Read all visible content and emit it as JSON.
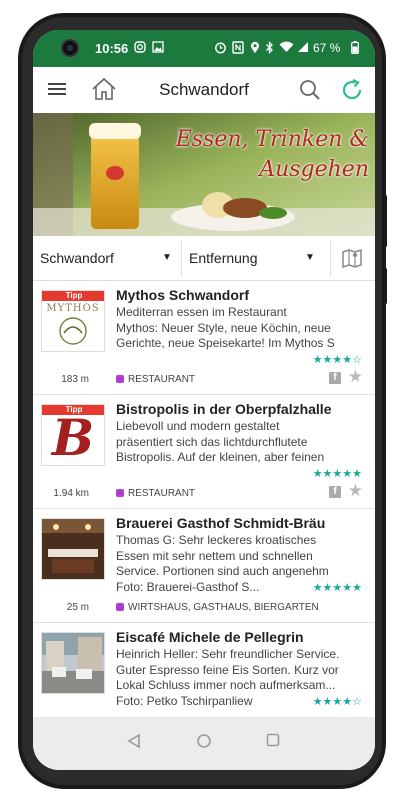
{
  "status": {
    "time": "10:56",
    "battery": "67 %"
  },
  "toolbar": {
    "title": "Schwandorf"
  },
  "banner": {
    "line1": "Essen, Trinken &",
    "line2": "Ausgehen"
  },
  "filters": {
    "location": "Schwandorf",
    "sort": "Entfernung"
  },
  "items": [
    {
      "name": "Mythos Schwandorf",
      "line1": "Mediterran essen im Restaurant",
      "line2": "Mythos: Neuer Style, neue Köchin, neue",
      "line3": "Gerichte, neue Speisekarte! Im Mythos S",
      "rating": 4,
      "distance": "183 m",
      "category": "RESTAURANT",
      "tipp": "Tipp",
      "thumb_text": "MYTHOS",
      "has_facebook": true
    },
    {
      "name": "Bistropolis in der Oberpfalzhalle",
      "line1": "Liebevoll und modern gestaltet",
      "line2": "präsentiert sich das lichtdurchflutete",
      "line3": "Bistropolis. Auf der kleinen, aber feinen",
      "rating": 5,
      "distance": "1.94 km",
      "category": "RESTAURANT",
      "tipp": "Tipp",
      "thumb_text": "B",
      "has_facebook": true
    },
    {
      "name": "Brauerei Gasthof Schmidt-Bräu",
      "line1": "Thomas G: Sehr leckeres kroatisches",
      "line2": "Essen mit sehr nettem und schnellen",
      "line3": "Service. Portionen sind auch angenehm",
      "line4": "Foto: Brauerei-Gasthof S...",
      "rating": 5,
      "distance": "25 m",
      "category": "WIRTSHAUS, GASTHAUS, BIERGARTEN",
      "has_facebook": false
    },
    {
      "name": "Eiscafé Michele de Pellegrin",
      "line1": "Heinrich Heller: Sehr freundlicher Service.",
      "line2": "Guter Espresso feine Eis Sorten. Kurz vor",
      "line3": "Lokal Schluss immer noch aufmerksam...",
      "line4": "Foto: Petko Tschirpanliew",
      "rating": 4,
      "has_facebook": false
    }
  ],
  "colors": {
    "statusbar": "#1d7a3f",
    "accent": "#1aa89d",
    "category_dot": "#b33ad0",
    "tipp": "#e53a2f"
  },
  "icons": [
    "menu-icon",
    "home-icon",
    "search-icon",
    "refresh-icon",
    "map-icon",
    "facebook-icon",
    "star-icon",
    "back-icon",
    "home-nav-icon",
    "recents-icon"
  ]
}
